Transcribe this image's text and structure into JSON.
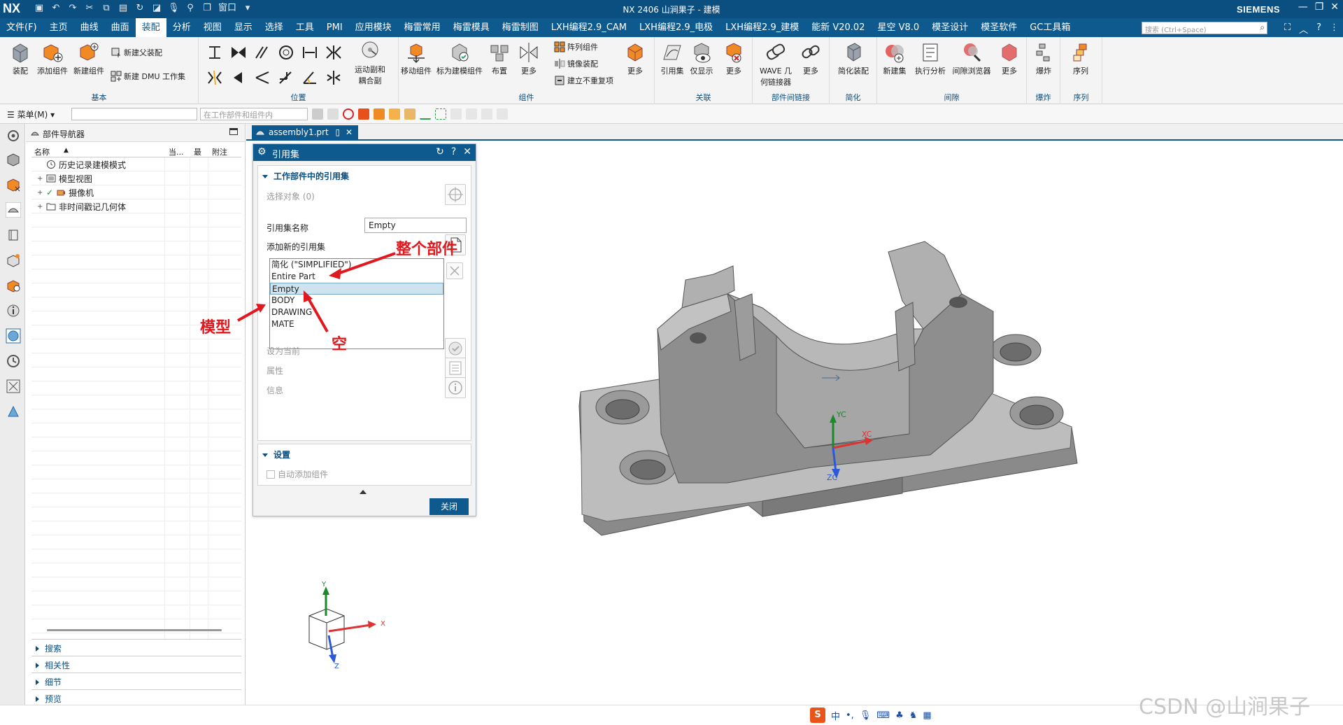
{
  "window": {
    "logo": "NX",
    "title": "NX 2406 山涧果子 - 建模",
    "brand": "SIEMENS",
    "quick_window": "窗口"
  },
  "menu": {
    "items": [
      "文件(F)",
      "主页",
      "曲线",
      "曲面",
      "装配",
      "分析",
      "视图",
      "显示",
      "选择",
      "工具",
      "PMI",
      "应用模块",
      "梅雷常用",
      "梅雷模具",
      "梅雷制图",
      "LXH编程2.9_CAM",
      "LXH编程2.9_电极",
      "LXH编程2.9_建模",
      "能新 V20.02",
      "星空 V8.0",
      "模圣设计",
      "模圣软件",
      "GC工具箱"
    ],
    "active": "装配",
    "search_placeholder": "搜索 (Ctrl+Space)"
  },
  "ribbon": {
    "groups": {
      "basic": "基本",
      "position": "位置",
      "component": "组件",
      "association": "关联",
      "interpart": "部件间链接",
      "simplify": "简化",
      "clearance": "间隙",
      "explode": "爆炸",
      "sequence": "序列"
    },
    "buttons": {
      "assembly": "装配",
      "add_component": "添加组件",
      "new_component": "新建组件",
      "new_parent": "新建父装配",
      "new_dmu": "新建 DMU 工作集",
      "motion_pair_1": "运动副和",
      "motion_pair_2": "耦合副",
      "move_component": "移动组件",
      "mark_as_model": "标为建模组件",
      "arrange": "布置",
      "more": "更多",
      "array_component": "阵列组件",
      "mirror_assembly": "镜像装配",
      "create_non_repeat": "建立不重复项",
      "reference_set": "引用集",
      "show_only": "仅显示",
      "wave_1": "WAVE 几",
      "wave_2": "何链接器",
      "simplify_assembly": "简化装配",
      "new_set": "新建集",
      "run_analysis": "执行分析",
      "clearance_browser": "间隙浏览器",
      "explode": "爆炸",
      "sequence": "序列"
    }
  },
  "selection_bar": {
    "menu": "菜单(M)",
    "filter_placeholder": "",
    "scope": "在工作部件和组件内"
  },
  "navigator": {
    "title": "部件导航器",
    "columns": [
      "名称",
      "当...",
      "最",
      "附注"
    ],
    "tree": [
      "历史记录建模模式",
      "模型视图",
      "摄像机",
      "非时间戳记几何体"
    ],
    "sections": [
      "搜索",
      "相关性",
      "细节",
      "预览"
    ]
  },
  "tab": {
    "label": "assembly1.prt"
  },
  "dialog": {
    "title": "引用集",
    "section_1": "工作部件中的引用集",
    "select_object": "选择对象 (0)",
    "ref_name_label": "引用集名称",
    "ref_name_value": "Empty",
    "add_new_label": "添加新的引用集",
    "list_items": [
      "简化 (\"SIMPLIFIED\")",
      "Entire Part",
      "Empty",
      "BODY",
      "DRAWING",
      "MATE"
    ],
    "selected_item": "Empty",
    "set_current": "设为当前",
    "attributes": "属性",
    "info": "信息",
    "section_2": "设置",
    "auto_add": "自动添加组件",
    "close": "关闭"
  },
  "annotations": {
    "entire_part": "整个部件",
    "model": "模型",
    "empty": "空"
  },
  "axes": {
    "yc": "YC",
    "xc": "XC",
    "zc": "ZC",
    "x": "X",
    "y": "Y",
    "z": "Z"
  },
  "status_bar": {
    "ime_logo": "S",
    "ime_lang": "中",
    "ime_punct": "•,",
    "watermark": "CSDN @山涧果子"
  },
  "colors": {
    "title_bg": "#0b4f80",
    "menu_bg": "#0e5a8e",
    "accent_orange": "#f08a24",
    "annotation_red": "#e0191f",
    "part_gray": "#8d8d8d"
  }
}
